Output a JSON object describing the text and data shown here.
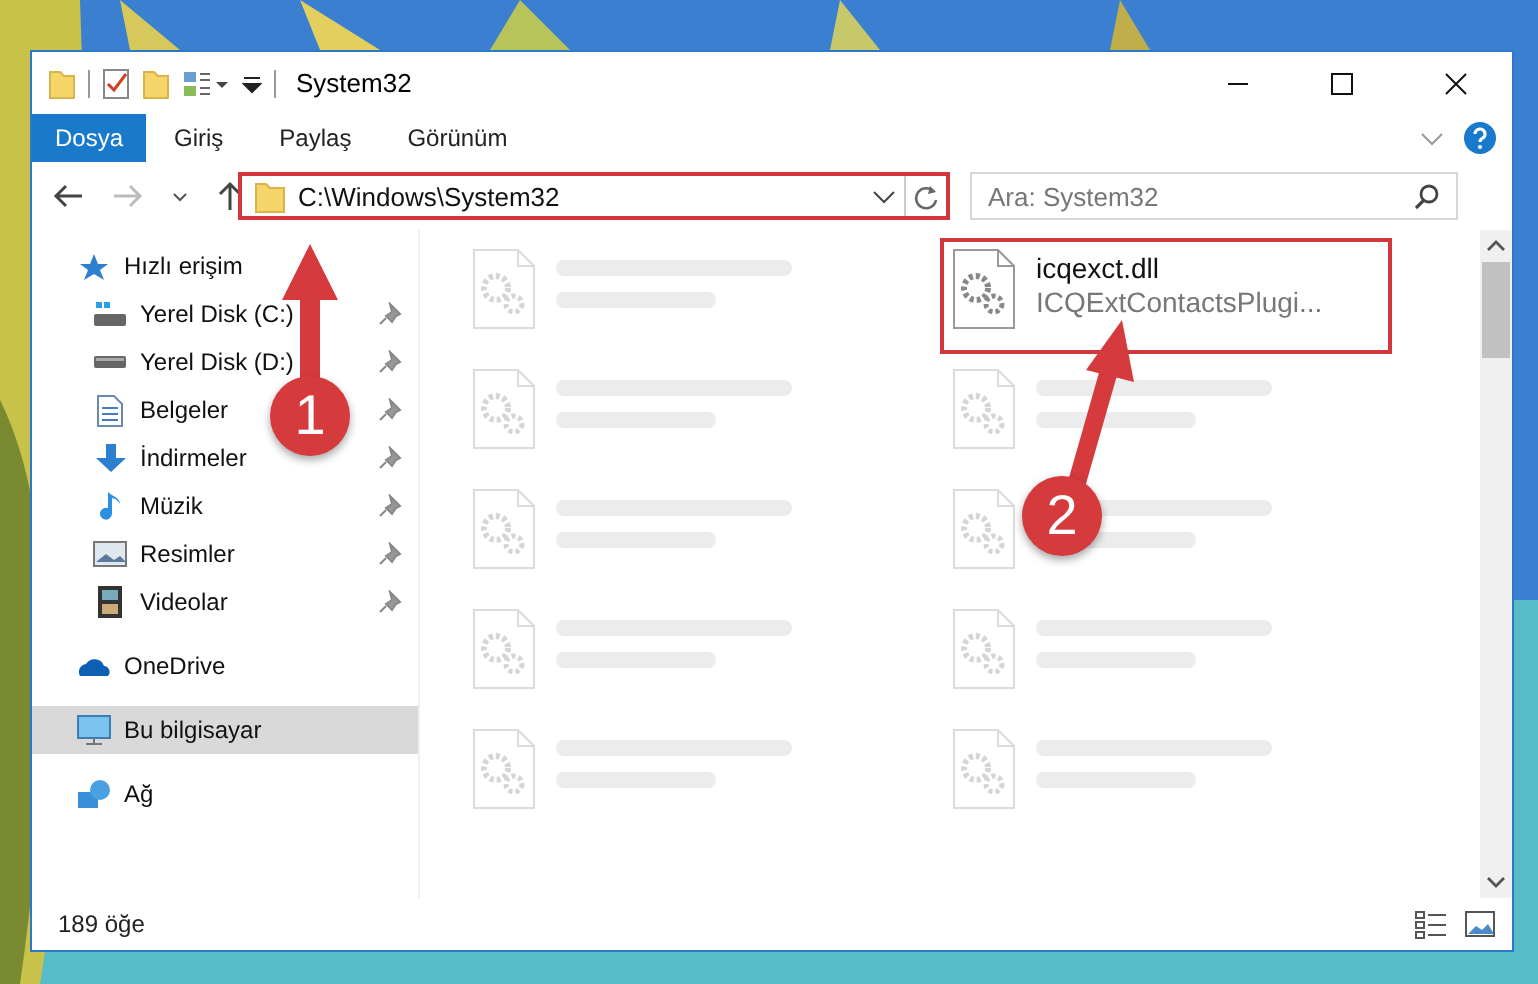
{
  "window": {
    "title": "System32"
  },
  "ribbon_tabs": [
    {
      "label": "Dosya",
      "selected": true
    },
    {
      "label": "Giriş",
      "selected": false
    },
    {
      "label": "Paylaş",
      "selected": false
    },
    {
      "label": "Görünüm",
      "selected": false
    }
  ],
  "address": {
    "path": "C:\\Windows\\System32",
    "highlighted": true
  },
  "search": {
    "placeholder": "Ara: System32"
  },
  "nav": {
    "items": [
      {
        "label": "Hızlı erişim",
        "selected": false,
        "children": [
          {
            "label": "Yerel Disk (C:)",
            "pinned": true
          },
          {
            "label": "Yerel Disk (D:)",
            "pinned": true
          },
          {
            "label": "Belgeler",
            "pinned": true
          },
          {
            "label": "İndirmeler",
            "pinned": true
          },
          {
            "label": "Müzik",
            "pinned": true
          },
          {
            "label": "Resimler",
            "pinned": true
          },
          {
            "label": "Videolar",
            "pinned": true
          }
        ]
      },
      {
        "label": "OneDrive",
        "selected": false
      },
      {
        "label": "Bu bilgisayar",
        "selected": true
      },
      {
        "label": "Ağ",
        "selected": false
      }
    ]
  },
  "files": [
    {
      "blurred": true,
      "highlighted": false
    },
    {
      "name": "icqexct.dll",
      "type": "ICQExtContactsPlugi...",
      "blurred": false,
      "highlighted": true
    },
    {
      "blurred": true,
      "highlighted": false
    },
    {
      "blurred": true,
      "highlighted": false
    },
    {
      "blurred": true,
      "highlighted": false
    },
    {
      "blurred": true,
      "highlighted": false
    },
    {
      "blurred": true,
      "highlighted": false
    },
    {
      "blurred": true,
      "highlighted": false
    },
    {
      "blurred": true,
      "highlighted": false
    },
    {
      "blurred": true,
      "highlighted": false
    }
  ],
  "status_bar": {
    "count": "189 öğe"
  },
  "annotations": [
    {
      "label": "1"
    },
    {
      "label": "2"
    }
  ]
}
